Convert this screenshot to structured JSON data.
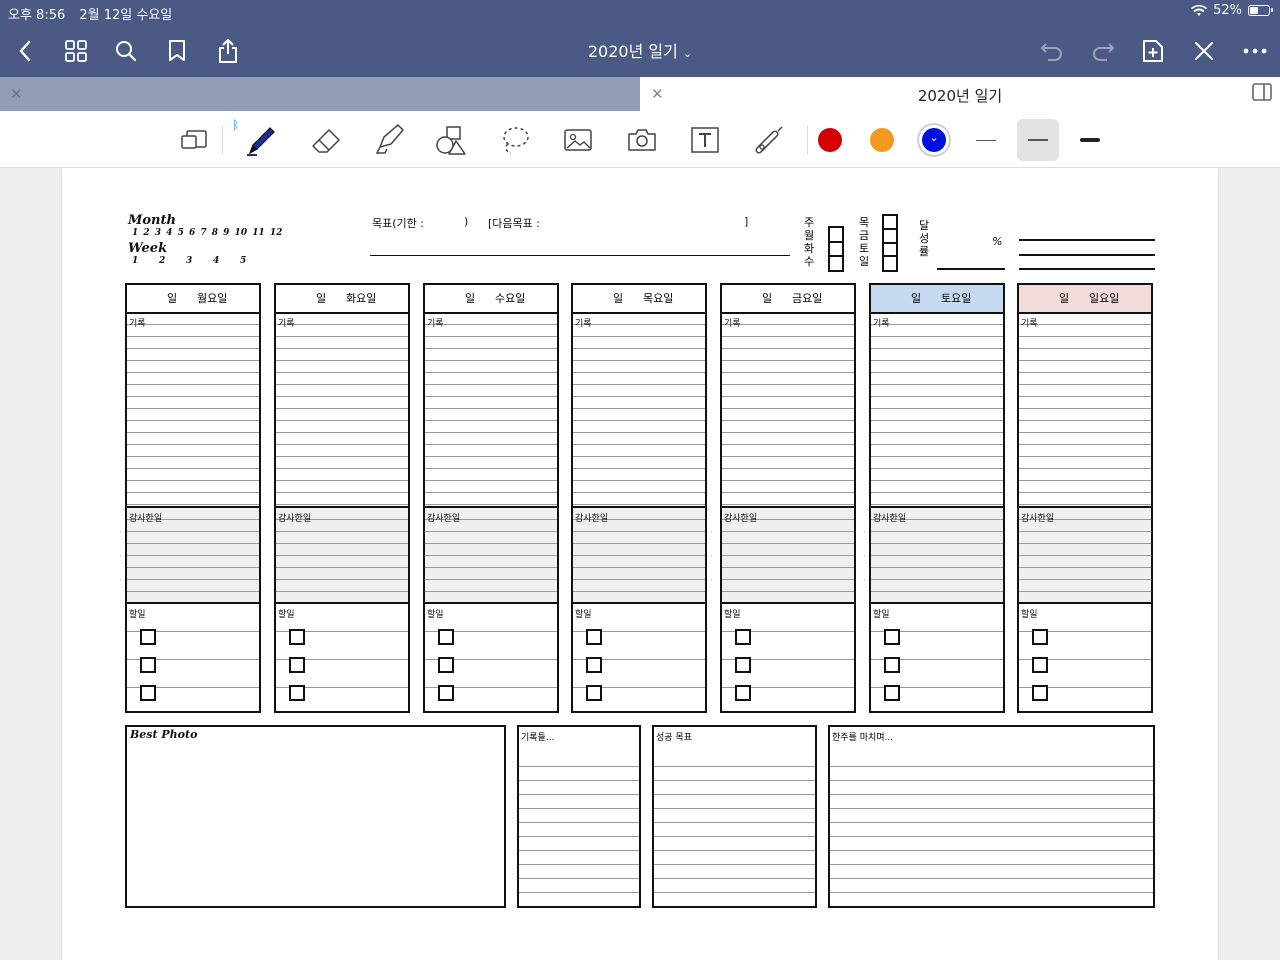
{
  "status": {
    "time": "오후 8:56",
    "date": "2월 12일 수요일",
    "battery": "52%",
    "battery_level": 0.52
  },
  "nav": {
    "title": "2020년 일기"
  },
  "tabs": [
    {
      "label": ""
    },
    {
      "label": "2020년 일기"
    }
  ],
  "toolbar": {
    "colors": [
      "#d40000",
      "#f39a1e",
      "#0010e0"
    ],
    "selected_color": "#0010e0"
  },
  "planner": {
    "month_label": "Month",
    "months": "1 2 3 4 5 6 7 8 9 10 11 12",
    "week_label": "Week",
    "weeks": [
      "1",
      "2",
      "3",
      "4",
      "5"
    ],
    "goal_label": "목표(기한 :",
    "goal_close": ")",
    "next_goal_label": "[다음목표 :",
    "next_goal_close": "]",
    "freq_chars": [
      "주",
      "월",
      "화",
      "수"
    ],
    "freq_chars2": [
      "목",
      "금",
      "토",
      "일"
    ],
    "achieve_chars": [
      "달",
      "성",
      "률"
    ],
    "percent": "%",
    "day_prefix": "일",
    "days": [
      {
        "name": "월요일",
        "bg": "#ffffff"
      },
      {
        "name": "화요일",
        "bg": "#ffffff"
      },
      {
        "name": "수요일",
        "bg": "#ffffff"
      },
      {
        "name": "목요일",
        "bg": "#ffffff"
      },
      {
        "name": "금요일",
        "bg": "#ffffff"
      },
      {
        "name": "토요일",
        "bg": "#c5d9f1"
      },
      {
        "name": "일요일",
        "bg": "#f2dcdb"
      }
    ],
    "record_label": "기록",
    "gratitude_label": "감사한일",
    "todo_label": "할일",
    "best_photo": "Best Photo",
    "box2": "기록들...",
    "box3": "성공 목표",
    "box4": "한주를 마치며..."
  }
}
